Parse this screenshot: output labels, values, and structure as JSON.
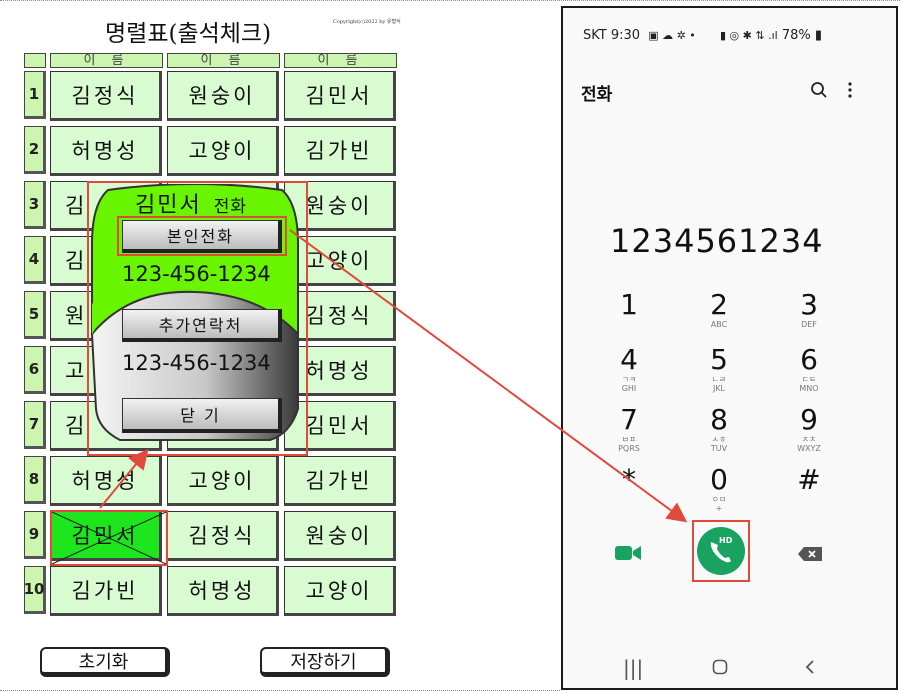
{
  "sheet": {
    "title": "명렬표(출석체크)",
    "copyright": "Copyright(c)2022 by 유형식",
    "header_label": "이 름",
    "rows": [
      {
        "num": "1",
        "cells": [
          "김정식",
          "원숭이",
          "김민서"
        ]
      },
      {
        "num": "2",
        "cells": [
          "허명성",
          "고양이",
          "김가빈"
        ]
      },
      {
        "num": "3",
        "cells": [
          "김",
          "",
          "원숭이"
        ]
      },
      {
        "num": "4",
        "cells": [
          "김",
          "",
          "고양이"
        ]
      },
      {
        "num": "5",
        "cells": [
          "원",
          "",
          "김정식"
        ]
      },
      {
        "num": "6",
        "cells": [
          "고",
          "",
          "허명성"
        ]
      },
      {
        "num": "7",
        "cells": [
          "김",
          "",
          "김민서"
        ]
      },
      {
        "num": "8",
        "cells": [
          "허명성",
          "고양이",
          "김가빈"
        ]
      },
      {
        "num": "9",
        "cells": [
          "김민서",
          "김정식",
          "원숭이"
        ]
      },
      {
        "num": "10",
        "cells": [
          "김가빈",
          "허명성",
          "고양이"
        ]
      }
    ],
    "reset_label": "초기화",
    "save_label": "저장하기"
  },
  "popup": {
    "name": "김민서",
    "suffix": "전화",
    "self_call_label": "본인전화",
    "self_number": "123-456-1234",
    "extra_contact_label": "추가연락처",
    "extra_number": "123-456-1234",
    "close_label": "닫 기"
  },
  "phone": {
    "status_left": "SKT 9:30",
    "status_right": "78%",
    "app_title": "전화",
    "dialed": "1234561234",
    "keys": [
      {
        "d": "1",
        "l": ""
      },
      {
        "d": "2",
        "l": "ABC"
      },
      {
        "d": "3",
        "l": "DEF"
      },
      {
        "d": "4",
        "l": "ㄱㅋ\nGHI"
      },
      {
        "d": "5",
        "l": "ㄴㄹ\nJKL"
      },
      {
        "d": "6",
        "l": "ㄷㅌ\nMNO"
      },
      {
        "d": "7",
        "l": "ㅂㅍ\nPQRS"
      },
      {
        "d": "8",
        "l": "ㅅㅎ\nTUV"
      },
      {
        "d": "9",
        "l": "ㅈㅊ\nWXYZ"
      },
      {
        "d": "*",
        "l": ""
      },
      {
        "d": "0",
        "l": "ㅇㅁ\n+"
      },
      {
        "d": "#",
        "l": ""
      }
    ],
    "call_badge": "HD"
  },
  "colors": {
    "popup_green": "#69f500",
    "cell_green": "#d9fbd1",
    "selected_green": "#1ee61e",
    "highlight_red": "#e04a3a",
    "call_green": "#1aa260"
  }
}
